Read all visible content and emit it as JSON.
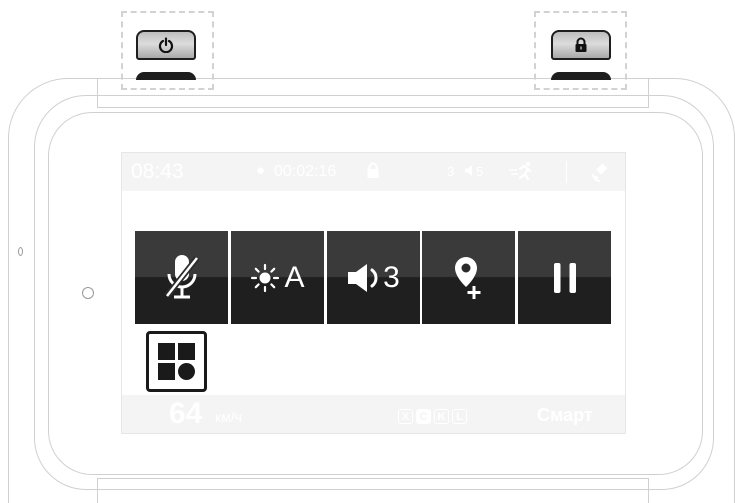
{
  "hardware": {
    "power_icon": "power-icon",
    "lock_icon": "lock-icon"
  },
  "status": {
    "time": "08:43",
    "record_dot": "●",
    "record_time": "00:02:16",
    "lock_icon": "lock-icon",
    "count": "3",
    "volume_icon": "speaker-icon",
    "volume": "5",
    "motion_icon": "running-icon",
    "gps_icon": "satellite-icon"
  },
  "controls": [
    {
      "id": "mic",
      "icon": "mic-off-icon"
    },
    {
      "id": "brightness",
      "icon": "sun-icon",
      "label": "A"
    },
    {
      "id": "volume",
      "icon": "speaker-icon",
      "label": "3"
    },
    {
      "id": "poi",
      "icon": "map-pin-add-icon"
    },
    {
      "id": "pause",
      "icon": "pause-icon"
    }
  ],
  "mode_button": {
    "icon": "grid-icon"
  },
  "bottom": {
    "speed": "64",
    "speed_unit": "км/ч",
    "bands": [
      "X",
      "C",
      "K",
      "L"
    ],
    "mode": "Смарт"
  },
  "colors": {
    "tile_top": "#3a3a3a",
    "tile_bottom": "#1f1f1f",
    "bar_bg": "#f4f4f4",
    "outline": "#d0d0d0"
  }
}
